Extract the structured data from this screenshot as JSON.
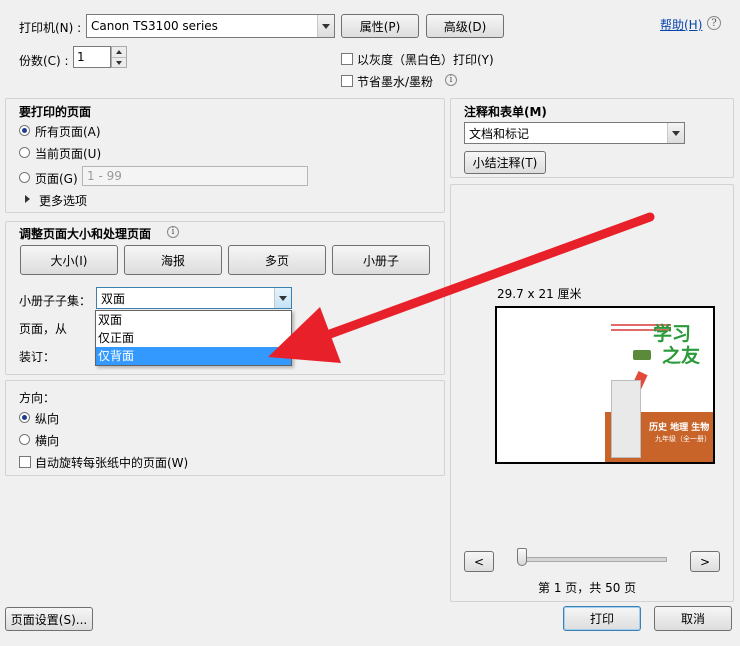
{
  "printer": {
    "label": "打印机(N) :",
    "selected": "Canon TS3100 series",
    "properties_button": "属性(P)",
    "advanced_button": "高级(D)",
    "help_link": "帮助(H)"
  },
  "copies": {
    "label": "份数(C) :",
    "value": "1"
  },
  "options": {
    "grayscale": "以灰度（黑白色）打印(Y)",
    "save_ink": "节省墨水/墨粉"
  },
  "pages_to_print": {
    "title": "要打印的页面",
    "all": "所有页面(A)",
    "current": "当前页面(U)",
    "pages": "页面(G)",
    "pages_placeholder": "1 - 99",
    "more_options": "更多选项"
  },
  "size_handling": {
    "title": "调整页面大小和处理页面",
    "tabs": [
      "大小(I)",
      "海报",
      "多页",
      "小册子"
    ],
    "booklet_subset_label": "小册子子集：",
    "booklet_subset_value": "双面",
    "pages_from_label": "页面，从",
    "binding_label": "装订："
  },
  "dropdown": {
    "items": [
      "双面",
      "仅正面",
      "仅背面"
    ],
    "selected_index": 2
  },
  "orientation": {
    "title": "方向：",
    "portrait": "纵向",
    "landscape": "横向",
    "auto_rotate": "自动旋转每张纸中的页面(W)"
  },
  "comments_forms": {
    "title": "注释和表单(M)",
    "selected": "文档和标记",
    "summarize_button": "小结注释(T)"
  },
  "preview": {
    "paper_size": "29.7 x 21 厘米",
    "page_counter": "第 1 页，共 50 页",
    "cover": {
      "title_top": "学习",
      "title_bottom": "之友",
      "subjects": "历史 地理 生物",
      "grade": "九年级（全一册）"
    }
  },
  "footer": {
    "page_setup_button": "页面设置(S)...",
    "print_button": "打印",
    "cancel_button": "取消"
  },
  "colors": {
    "annotation_arrow": "#e8202a",
    "cover_band": "#c8642a",
    "cover_title": "#2a9a3a",
    "selection": "#3399ff"
  }
}
